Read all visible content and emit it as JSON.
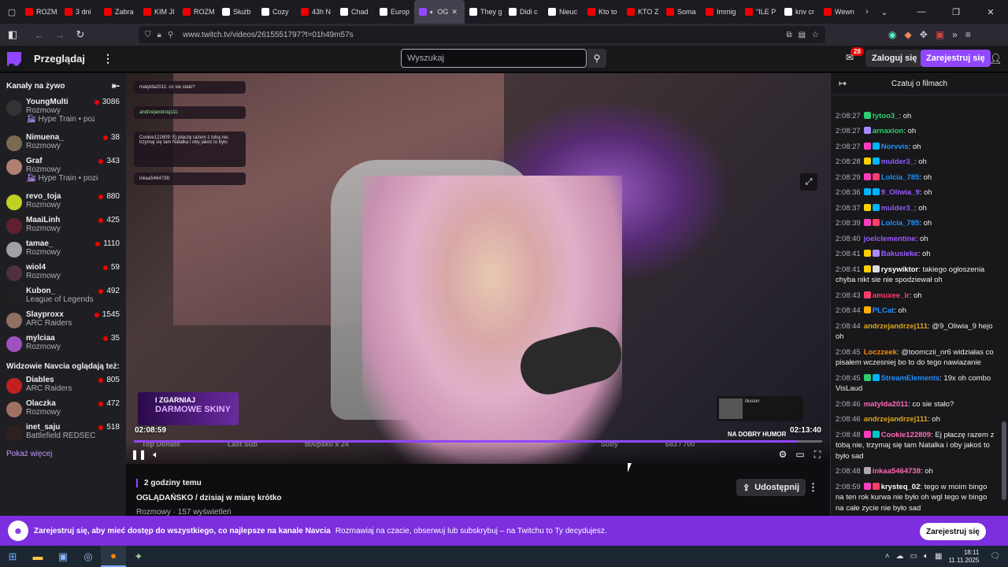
{
  "browser": {
    "tabs": [
      {
        "label": "ROZM",
        "icon": "youtube-icon",
        "color": "#e00"
      },
      {
        "label": "3 dni",
        "icon": "youtube-icon",
        "color": "#e00"
      },
      {
        "label": "Zabra",
        "icon": "youtube-icon",
        "color": "#e00"
      },
      {
        "label": "KIM JI",
        "icon": "youtube-icon",
        "color": "#e00"
      },
      {
        "label": "ROZM",
        "icon": "youtube-icon",
        "color": "#e00"
      },
      {
        "label": "Służb",
        "icon": "x-icon",
        "color": "#fff"
      },
      {
        "label": "Cozy",
        "icon": "x-icon",
        "color": "#fff"
      },
      {
        "label": "43h N",
        "icon": "youtube-icon",
        "color": "#e00"
      },
      {
        "label": "Chad",
        "icon": "x-icon",
        "color": "#fff"
      },
      {
        "label": "Europ",
        "icon": "globe-icon",
        "color": "#fff"
      },
      {
        "label": "OG",
        "icon": "twitch-icon",
        "color": "#9147ff",
        "active": true
      },
      {
        "label": "They g",
        "icon": "x-icon",
        "color": "#fff"
      },
      {
        "label": "Didi c",
        "icon": "x-icon",
        "color": "#fff"
      },
      {
        "label": "Nieuc",
        "icon": "x-icon",
        "color": "#fff"
      },
      {
        "label": "Kto to",
        "icon": "youtube-icon",
        "color": "#e00"
      },
      {
        "label": "KTO Z",
        "icon": "youtube-icon",
        "color": "#e00"
      },
      {
        "label": "Soma",
        "icon": "youtube-icon",
        "color": "#e00"
      },
      {
        "label": "Immig",
        "icon": "youtube-icon",
        "color": "#e00"
      },
      {
        "label": "\"ILE P",
        "icon": "youtube-icon",
        "color": "#e00"
      },
      {
        "label": "knv cr",
        "icon": "x-icon",
        "color": "#fff"
      },
      {
        "label": "Wewn",
        "icon": "youtube-icon",
        "color": "#e00"
      }
    ],
    "url": "www.twitch.tv/videos/2615551797?t=01h49m57s"
  },
  "topnav": {
    "browse": "Przeglądaj",
    "search_placeholder": "Wyszukaj",
    "notif_count": "28",
    "login": "Zaloguj się",
    "signup": "Zarejestruj się"
  },
  "sidebar": {
    "header": "Kanały na żywo",
    "channels": [
      {
        "name": "YoungMulti",
        "category": "Rozmowy",
        "viewers": "3086",
        "hype": "Hype Train • poziom 4",
        "color": "#333"
      },
      {
        "name": "Nimuena_",
        "category": "Rozmowy",
        "viewers": "38",
        "color": "#7a6a50"
      },
      {
        "name": "Graf",
        "category": "Rozmowy",
        "viewers": "343",
        "hype": "Hype Train • poziom 1",
        "color": "#b08070"
      },
      {
        "name": "revo_toja",
        "category": "Rozmowy",
        "viewers": "880",
        "color": "#c0d020"
      },
      {
        "name": "MaaiLinh",
        "category": "Rozmowy",
        "viewers": "425",
        "color": "#602030"
      },
      {
        "name": "tamae_",
        "category": "Rozmowy",
        "viewers": "1110",
        "color": "#a0a0a8"
      },
      {
        "name": "wiol4",
        "category": "Rozmowy",
        "viewers": "59",
        "color": "#503040"
      },
      {
        "name": "Kubon_",
        "category": "League of Legends",
        "viewers": "492",
        "color": "#202020"
      },
      {
        "name": "Slayproxx",
        "category": "ARC Raiders",
        "viewers": "1545",
        "color": "#907060"
      },
      {
        "name": "mylciaa",
        "category": "Rozmowy",
        "viewers": "35",
        "color": "#a050c0"
      }
    ],
    "also_watch_header": "Widzowie Navcia oglądają też:",
    "also": [
      {
        "name": "Diables",
        "category": "ARC Raiders",
        "viewers": "805",
        "color": "#c02020"
      },
      {
        "name": "Olaczka",
        "category": "Rozmowy",
        "viewers": "472",
        "color": "#a07060"
      },
      {
        "name": "inet_saju",
        "category": "Battlefield REDSEC",
        "viewers": "518",
        "color": "#302020"
      }
    ],
    "show_more": "Pokaż więcej"
  },
  "video": {
    "overlay_messages": [
      "matylda2011: co sie stało?",
      "andrzejandrzej111:",
      "Cookie122809: Ej płaczę razem z tobą nie, trzymaj się tam Natalka i oby jakoś to było",
      "inkaa5464738:"
    ],
    "promo_line1": "I ZGARNIAJ",
    "promo_line2": "DARMOWE SKINY",
    "now_playing": "illusion",
    "dobry_humor": "NA DOBRY HUMOR",
    "bottom_labels": [
      "Top Donate",
      "Last Sub",
      "d00psk0 x 24",
      "Suby",
      "683 / 700"
    ],
    "current_time": "02:08:59",
    "duration": "02:13:40",
    "progress": 0.965
  },
  "info": {
    "ago": "2 godziny temu",
    "title": "OGLĄDAŃSKO / dzisiaj w miarę krótko",
    "meta": "Rozmowy · 157 wyświetleń",
    "share": "Udostępnij"
  },
  "chat": {
    "header": "Czatuj o filmach",
    "messages": [
      {
        "t": "2:08:27",
        "u": "tytoo3_",
        "c": "#2ecc71",
        "m": ": oh",
        "badges": [
          "#2ecc71"
        ]
      },
      {
        "t": "2:08:27",
        "u": "arnaxion",
        "c": "#2ecc71",
        "m": ": oh",
        "badges": [
          "#aa88ff"
        ]
      },
      {
        "t": "2:08:27",
        "u": "Norvvis",
        "c": "#1e90ff",
        "m": ": oh",
        "badges": [
          "#ff3dbb",
          "#00b3ff"
        ]
      },
      {
        "t": "2:08:28",
        "u": "mulder3_",
        "c": "#8a5cff",
        "m": ": oh",
        "badges": [
          "#ffd000",
          "#00b3ff"
        ]
      },
      {
        "t": "2:08:29",
        "u": "Lolcia_785",
        "c": "#1e90ff",
        "m": ": oh",
        "badges": [
          "#ff3dbb",
          "#ff3d6a"
        ]
      },
      {
        "t": "2:08:36",
        "u": "9_Oliwia_9",
        "c": "#9b59ff",
        "m": ": oh",
        "badges": [
          "#00b3ff",
          "#00b3ff"
        ]
      },
      {
        "t": "2:08:37",
        "u": "mulder3_",
        "c": "#8a5cff",
        "m": ": oh",
        "badges": [
          "#ffd000",
          "#00b3ff"
        ]
      },
      {
        "t": "2:08:39",
        "u": "Lolcia_785",
        "c": "#1e90ff",
        "m": ": oh",
        "badges": [
          "#ff3dbb",
          "#ff3d6a"
        ]
      },
      {
        "t": "2:08:40",
        "u": "joelclementine",
        "c": "#9b59ff",
        "m": ": oh",
        "badges": []
      },
      {
        "t": "2:08:41",
        "u": "Bakusieke",
        "c": "#9b59ff",
        "m": ": oh",
        "badges": [
          "#ffd000",
          "#aa88ff"
        ]
      },
      {
        "t": "2:08:41",
        "u": "rysywiktor",
        "c": "#ffffff",
        "m": ": takiego ogłoszenia chyba nikt sie nie spodziewał oh",
        "badges": [
          "#ffd000",
          "#dddddd"
        ]
      },
      {
        "t": "2:08:43",
        "u": "amuxee_lr",
        "c": "#ff3d6a",
        "m": ": oh",
        "badges": [
          "#ff3d6a"
        ]
      },
      {
        "t": "2:08:44",
        "u": "PLCat",
        "c": "#1e90ff",
        "m": ": oh",
        "badges": [
          "#ffb000"
        ]
      },
      {
        "t": "2:08:44",
        "u": "andrzejandrzej111",
        "c": "#daa520",
        "m": ": @9_Oliwia_9 hejo oh",
        "badges": []
      },
      {
        "t": "2:08:45",
        "u": "Loczzeek",
        "c": "#ff8c00",
        "m": ": @toomczii_nr6 widziałas co pisałem wczesniej bo to do tego nawiazanie",
        "badges": []
      },
      {
        "t": "2:08:45",
        "u": "StreamElements",
        "c": "#1e90ff",
        "m": ": 19x oh combo VisLaud",
        "badges": [
          "#2ecc71",
          "#00b3ff"
        ]
      },
      {
        "t": "2:08:46",
        "u": "matylda2011",
        "c": "#ff69b4",
        "m": ": co sie stało?",
        "badges": []
      },
      {
        "t": "2:08:46",
        "u": "andrzejandrzej111",
        "c": "#daa520",
        "m": ": oh",
        "badges": []
      },
      {
        "t": "2:08:48",
        "u": "Cookie122809",
        "c": "#ff69b4",
        "m": ": Ej płaczę razem z tobą nie, trzymaj się tam Natalka i oby jakoś to było sad",
        "badges": [
          "#ff3dbb",
          "#00c8c8"
        ]
      },
      {
        "t": "2:08:48",
        "u": "inkaa5464738",
        "c": "#ff69b4",
        "m": ": oh",
        "badges": [
          "#aaaaaa"
        ]
      },
      {
        "t": "2:08:59",
        "u": "krysteq_02",
        "c": "#ffffff",
        "m": ": tego w moim bingo na ten rok kurwa nie było oh wgl tego w bingo na całe zycie nie było sad",
        "badges": [
          "#ff3dbb",
          "#ff3d6a"
        ]
      }
    ]
  },
  "banner": {
    "text": "Zarejestruj się, aby mieć dostęp do wszystkiego, co najlepsze na kanale Navcia",
    "sub": "Rozmawiaj na czacie, obserwuj lub subskrybuj – na Twitchu to Ty decydujesz.",
    "button": "Zarejestruj się"
  },
  "taskbar": {
    "time": "18:11",
    "date": "11.11.2025"
  }
}
